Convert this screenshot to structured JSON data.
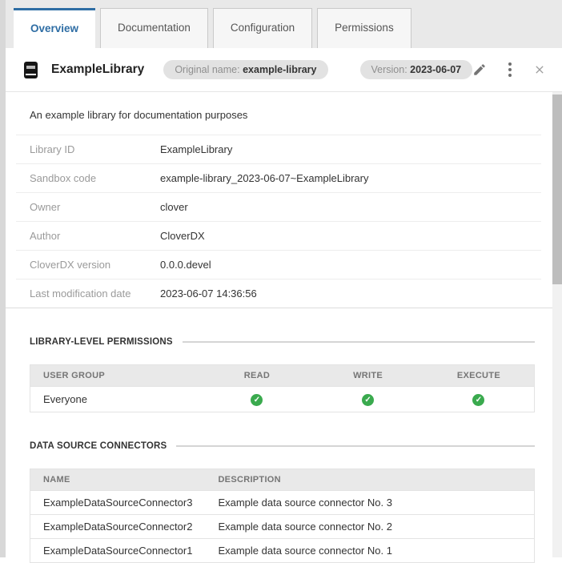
{
  "tabs": {
    "items": [
      {
        "label": "Overview",
        "active": true
      },
      {
        "label": "Documentation",
        "active": false
      },
      {
        "label": "Configuration",
        "active": false
      },
      {
        "label": "Permissions",
        "active": false
      }
    ]
  },
  "header": {
    "title": "ExampleLibrary",
    "original_name_label": "Original name:",
    "original_name_value": "example-library",
    "version_label": "Version:",
    "version_value": "2023-06-07"
  },
  "overview": {
    "description": "An example library for documentation purposes",
    "details": [
      {
        "label": "Library ID",
        "value": "ExampleLibrary"
      },
      {
        "label": "Sandbox code",
        "value": "example-library_2023-06-07~ExampleLibrary"
      },
      {
        "label": "Owner",
        "value": "clover"
      },
      {
        "label": "Author",
        "value": "CloverDX"
      },
      {
        "label": "CloverDX version",
        "value": "0.0.0.devel"
      },
      {
        "label": "Last modification date",
        "value": "2023-06-07 14:36:56"
      }
    ],
    "permissions": {
      "section_title": "LIBRARY-LEVEL PERMISSIONS",
      "headers": [
        "USER GROUP",
        "READ",
        "WRITE",
        "EXECUTE"
      ],
      "rows": [
        {
          "group": "Everyone",
          "read": "granted",
          "write": "granted",
          "execute": "granted"
        }
      ]
    },
    "connectors": {
      "section_title": "DATA SOURCE CONNECTORS",
      "headers": [
        "NAME",
        "DESCRIPTION"
      ],
      "rows": [
        {
          "name": "ExampleDataSourceConnector3",
          "description": "Example data source connector No. 3"
        },
        {
          "name": "ExampleDataSourceConnector2",
          "description": "Example data source connector No. 2"
        },
        {
          "name": "ExampleDataSourceConnector1",
          "description": "Example data source connector No. 1"
        }
      ]
    }
  },
  "icons": {
    "edit": "pencil-icon",
    "menu": "kebab-menu-icon",
    "close": "close-icon",
    "granted": "check-circle-icon"
  },
  "colors": {
    "accent": "#2e6da4",
    "success_green": "#3aaa4e"
  }
}
